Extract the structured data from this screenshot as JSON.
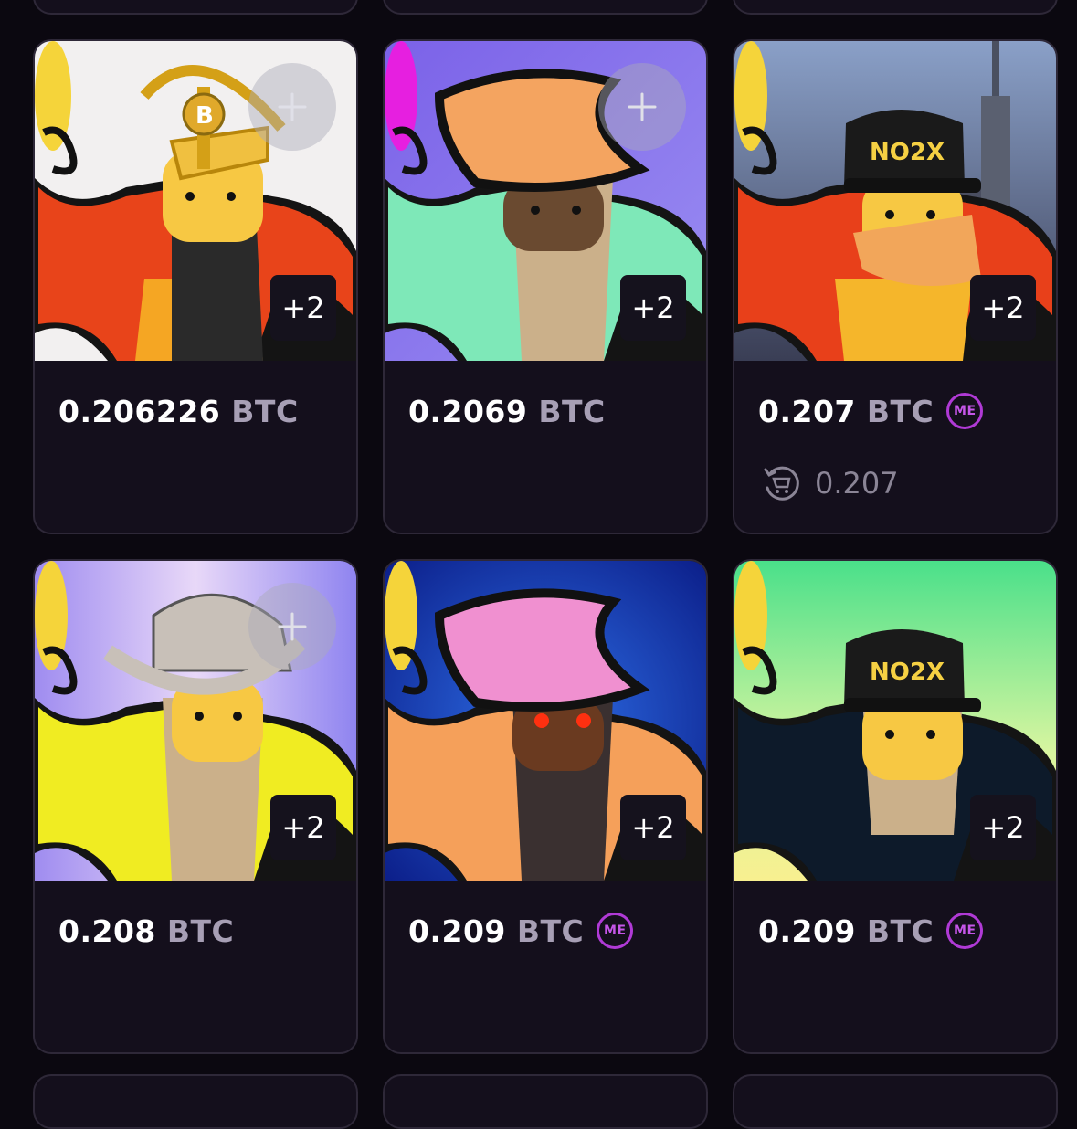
{
  "icons": {
    "add": "plus-icon",
    "marketplace": "magic-eden-icon",
    "buy_again": "cart-refresh-icon"
  },
  "colors": {
    "background": "#0b0810",
    "card": "#140f1c",
    "border": "#2e2838",
    "price": "#ffffff",
    "currency": "#a79fb5",
    "accent": "#b03ad6"
  },
  "cards": [
    {
      "price": "0.206226",
      "currency": "BTC",
      "badge": "+2",
      "hat_text": ""
    },
    {
      "price": "0.2069",
      "currency": "BTC",
      "badge": "+2",
      "hat_text": ""
    },
    {
      "price": "0.207",
      "currency": "BTC",
      "badge": "+2",
      "sub_price": "0.207",
      "hat_text": "NO2X"
    },
    {
      "price": "0.208",
      "currency": "BTC",
      "badge": "+2",
      "hat_text": ""
    },
    {
      "price": "0.209",
      "currency": "BTC",
      "badge": "+2",
      "hat_text": ""
    },
    {
      "price": "0.209",
      "currency": "BTC",
      "badge": "+2",
      "hat_text": "NO2X"
    }
  ]
}
